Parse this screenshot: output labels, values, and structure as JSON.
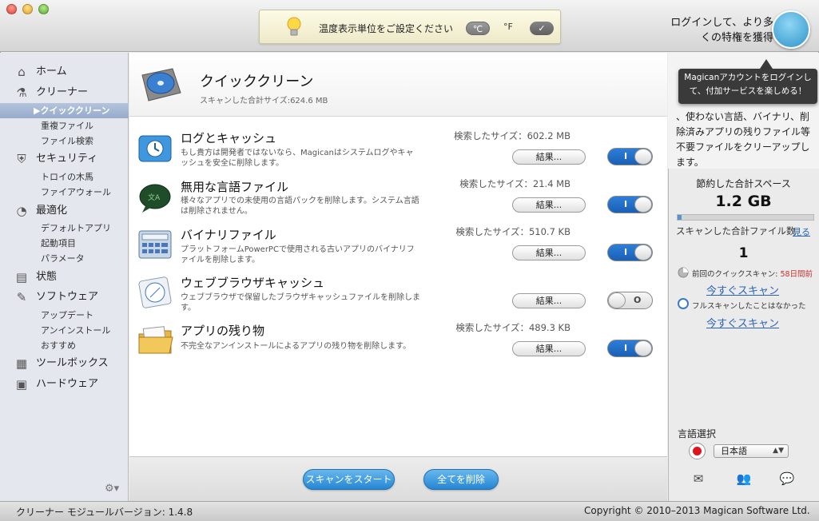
{
  "notice": {
    "text": "温度表示単位をご設定ください",
    "celsius": "℃",
    "fahrenheit": "°F",
    "confirm": "✓"
  },
  "login": {
    "text": "ログインして、より多くの特権を獲得",
    "tooltip": "Magicanアカウントをログインして、付加サービスを楽しめる！"
  },
  "sidebar": {
    "items": [
      {
        "label": "ホーム",
        "icon": "home-icon"
      },
      {
        "label": "クリーナー",
        "icon": "flask-icon"
      },
      {
        "label": "▶クイッククリーン"
      },
      {
        "label": "重複ファイル"
      },
      {
        "label": "ファイル検索"
      },
      {
        "label": "セキュリティ",
        "icon": "shield-icon"
      },
      {
        "label": "トロイの木馬"
      },
      {
        "label": "ファイアウォール"
      },
      {
        "label": "最適化",
        "icon": "gauge-icon"
      },
      {
        "label": "デフォルトアプリ"
      },
      {
        "label": "起動項目"
      },
      {
        "label": "パラメータ"
      },
      {
        "label": "状態",
        "icon": "chart-icon"
      },
      {
        "label": "ソフトウェア",
        "icon": "wrench-icon"
      },
      {
        "label": "アップデート"
      },
      {
        "label": "アンインストール"
      },
      {
        "label": "おすすめ"
      },
      {
        "label": "ツールボックス",
        "icon": "toolbox-icon"
      },
      {
        "label": "ハードウェア",
        "icon": "hardware-icon"
      }
    ]
  },
  "header": {
    "title": "クイッククリーン",
    "subtitle": "スキャンした合計サイズ:624.6 MB"
  },
  "items": [
    {
      "title": "ログとキャッシュ",
      "desc": "もし貴方は開発者ではないなら、Magicanはシステムログやキャッシュを安全に削除します。",
      "size": "検索したサイズ：602.2 MB",
      "result": "結果...",
      "enabled": true
    },
    {
      "title": "無用な言語ファイル",
      "desc": "様々なアプリでの未使用の言語パックを削除します。システム言語は削除されません。",
      "size": "検索したサイズ：21.4 MB",
      "result": "結果...",
      "enabled": true
    },
    {
      "title": "バイナリファイル",
      "desc": "プラットフォームPowerPCで使用される古いアプリのバイナリファイルを削除します。",
      "size": "検索したサイズ：510.7 KB",
      "result": "結果...",
      "enabled": true
    },
    {
      "title": "ウェブブラウザキャッシュ",
      "desc": "ウェブブラウザで保留したブラウザキャッシュファイルを削除します。",
      "size": "",
      "result": "結果...",
      "enabled": false
    },
    {
      "title": "アプリの残り物",
      "desc": "不完全なアンインストールによるアプリの残り物を削除します。",
      "size": "検索したサイズ：489.3 KB",
      "result": "結果...",
      "enabled": true
    }
  ],
  "toggle": {
    "on_mark": "I",
    "off_mark": "O"
  },
  "buttons": {
    "scan": "スキャンをスタート",
    "delete_all": "全てを削除"
  },
  "right": {
    "intro": "、使わない言語、バイナリ、削除済みアプリの残りファイル等不要ファイルをクリーアップします。",
    "saved_label": "節約した合計スペース",
    "saved_value": "1.2 GB",
    "saved_fraction": 0.03,
    "scanned_label": "スキャンした合計ファイル数",
    "scanned_link": "見る",
    "scanned_value": "1",
    "last_quick_prefix": "前回のクイックスキャン: ",
    "last_quick_days": "58日間前",
    "scan_now": "今すぐスキャン",
    "full_scan": "フルスキャンしたことはなかった",
    "scan_now2": "今すぐスキャン",
    "lang_label": "言語選択",
    "lang_value": "日本語"
  },
  "status": {
    "left": "クリーナー モジュールバージョン: 1.4.8",
    "right": "Copyright © 2010–2013 Magican Software Ltd."
  },
  "colors": {
    "accent": "#2686d3",
    "toggle_on": "#1a5fb5",
    "selected_nav": "#97aacb",
    "link": "#2a64b8"
  }
}
